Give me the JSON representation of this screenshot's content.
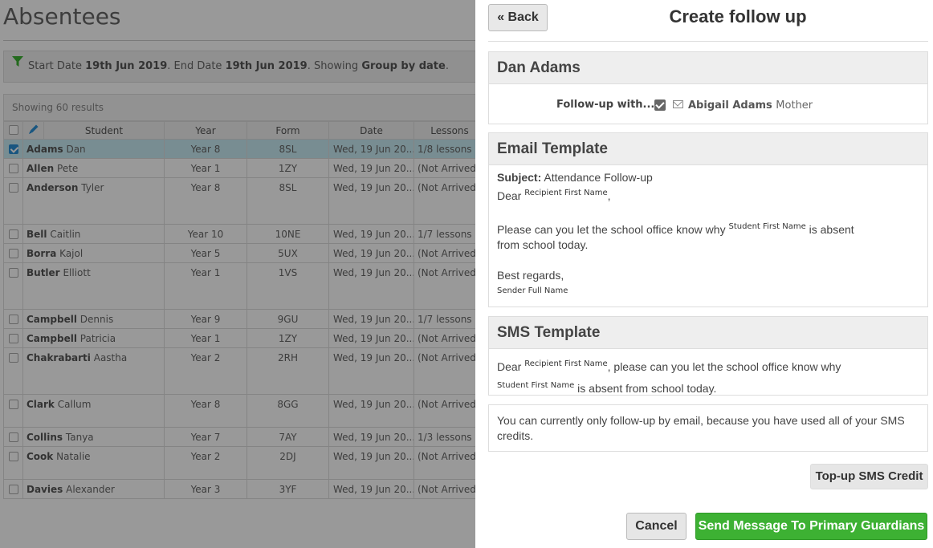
{
  "page": {
    "title": "Absentees",
    "filter": {
      "start_label": "Start Date",
      "start_date": "19th Jun 2019",
      "end_label": ". End Date",
      "end_date": "19th Jun 2019",
      "showing_label": ". Showing",
      "grouping": "Group by date",
      "suffix": "."
    },
    "results_text": "Showing 60 results",
    "columns": [
      "Student",
      "Year",
      "Form",
      "Date",
      "Lessons"
    ],
    "rows": [
      {
        "last": "Adams",
        "first": "Dan",
        "year": "Year 8",
        "form": "8SL",
        "date": "Wed, 19 Jun 20...",
        "lessons": "1/8 lessons",
        "checked": true
      },
      {
        "last": "Allen",
        "first": "Pete",
        "year": "Year 1",
        "form": "1ZY",
        "date": "Wed, 19 Jun 20...",
        "lessons": "(Not Arrived)"
      },
      {
        "last": "Anderson",
        "first": "Tyler",
        "year": "Year 8",
        "form": "8SL",
        "date": "Wed, 19 Jun 20...",
        "lessons": "(Not Arrived)"
      },
      {
        "last": "Bell",
        "first": "Caitlin",
        "year": "Year 10",
        "form": "10NE",
        "date": "Wed, 19 Jun 20...",
        "lessons": "1/7 lessons"
      },
      {
        "last": "Borra",
        "first": "Kajol",
        "year": "Year 5",
        "form": "5UX",
        "date": "Wed, 19 Jun 20...",
        "lessons": "(Not Arrived)"
      },
      {
        "last": "Butler",
        "first": "Elliott",
        "year": "Year 1",
        "form": "1VS",
        "date": "Wed, 19 Jun 20...",
        "lessons": "(Not Arrived)"
      },
      {
        "last": "Campbell",
        "first": "Dennis",
        "year": "Year 9",
        "form": "9GU",
        "date": "Wed, 19 Jun 20...",
        "lessons": "1/7 lessons"
      },
      {
        "last": "Campbell",
        "first": "Patricia",
        "year": "Year 1",
        "form": "1ZY",
        "date": "Wed, 19 Jun 20...",
        "lessons": "(Not Arrived)"
      },
      {
        "last": "Chakrabarti",
        "first": "Aastha",
        "year": "Year 2",
        "form": "2RH",
        "date": "Wed, 19 Jun 20...",
        "lessons": "(Not Arrived)"
      },
      {
        "last": "Clark",
        "first": "Callum",
        "year": "Year 8",
        "form": "8GG",
        "date": "Wed, 19 Jun 20...",
        "lessons": "(Not Arrived)"
      },
      {
        "last": "Collins",
        "first": "Tanya",
        "year": "Year 7",
        "form": "7AY",
        "date": "Wed, 19 Jun 20...",
        "lessons": "1/3 lessons"
      },
      {
        "last": "Cook",
        "first": "Natalie",
        "year": "Year 2",
        "form": "2DJ",
        "date": "Wed, 19 Jun 20...",
        "lessons": "(Not Arrived)"
      },
      {
        "last": "Davies",
        "first": "Alexander",
        "year": "Year 3",
        "form": "3YF",
        "date": "Wed, 19 Jun 20...",
        "lessons": "(Not Arrived)"
      }
    ]
  },
  "modal": {
    "back_label": "« Back",
    "title": "Create follow up",
    "student_name": "Dan Adams",
    "follow_up_label": "Follow-up with...",
    "guardian_name": "Abigail Adams",
    "guardian_relation": "Mother",
    "email": {
      "heading": "Email Template",
      "subject_label": "Subject:",
      "subject": "Attendance Follow-up",
      "dear": "Dear",
      "recipient_placeholder": "Recipient First Name",
      "comma": ",",
      "body_pre": "Please can you let the school office know why",
      "student_placeholder": "Student First Name",
      "body_post": "is absent",
      "body_line2": "from school today.",
      "signoff": "Best regards,",
      "sender_placeholder": "Sender Full Name"
    },
    "sms": {
      "heading": "SMS Template",
      "dear": "Dear",
      "recipient_placeholder": "Recipient First Name",
      "body_pre": ", please can you let the school office know why",
      "student_placeholder": "Student First Name",
      "body_post": "is absent from school today."
    },
    "notice": "You can currently only follow-up by email, because you have used all of your SMS credits.",
    "topup_label": "Top-up SMS Credit",
    "cancel_label": "Cancel",
    "send_label": "Send Message To Primary Guardians"
  },
  "colors": {
    "send_button": "#3db133",
    "selected_row": "#c9ebf3",
    "filter_icon": "#3db133"
  }
}
